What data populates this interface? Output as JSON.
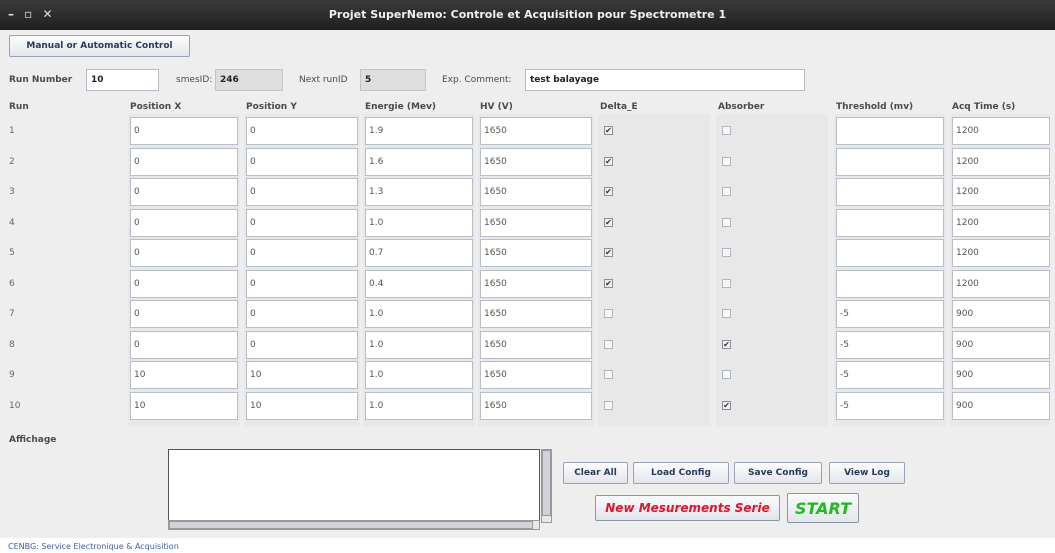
{
  "window": {
    "controls": "– ▫ ✕",
    "title": "Projet SuperNemo: Controle et Acquisition  pour Spectrometre 1"
  },
  "mode_button": "Manual or Automatic Control",
  "header": {
    "run_number_label": "Run Number",
    "run_number_value": "10",
    "smes_label": "smesID:",
    "smes_value": "246",
    "next_run_label": "Next runID",
    "next_run_value": "5",
    "comment_label": "Exp. Comment:",
    "comment_value": "test balayage"
  },
  "columns": [
    "Run",
    "Position X",
    "Position Y",
    "Energie (Mev)",
    "HV (V)",
    "Delta_E",
    "Absorber",
    "Threshold (mv)",
    "Acq Time (s)"
  ],
  "rows": [
    {
      "run": "1",
      "x": "0",
      "y": "0",
      "energie": "1.9",
      "hv": "1650",
      "delta": true,
      "absorber": false,
      "threshold": "",
      "acq": "1200"
    },
    {
      "run": "2",
      "x": "0",
      "y": "0",
      "energie": "1.6",
      "hv": "1650",
      "delta": true,
      "absorber": false,
      "threshold": "",
      "acq": "1200"
    },
    {
      "run": "3",
      "x": "0",
      "y": "0",
      "energie": "1.3",
      "hv": "1650",
      "delta": true,
      "absorber": false,
      "threshold": "",
      "acq": "1200"
    },
    {
      "run": "4",
      "x": "0",
      "y": "0",
      "energie": "1.0",
      "hv": "1650",
      "delta": true,
      "absorber": false,
      "threshold": "",
      "acq": "1200"
    },
    {
      "run": "5",
      "x": "0",
      "y": "0",
      "energie": "0.7",
      "hv": "1650",
      "delta": true,
      "absorber": false,
      "threshold": "",
      "acq": "1200"
    },
    {
      "run": "6",
      "x": "0",
      "y": "0",
      "energie": "0.4",
      "hv": "1650",
      "delta": true,
      "absorber": false,
      "threshold": "",
      "acq": "1200"
    },
    {
      "run": "7",
      "x": "0",
      "y": "0",
      "energie": "1.0",
      "hv": "1650",
      "delta": false,
      "absorber": false,
      "threshold": "-5",
      "acq": "900"
    },
    {
      "run": "8",
      "x": "0",
      "y": "0",
      "energie": "1.0",
      "hv": "1650",
      "delta": false,
      "absorber": true,
      "threshold": "-5",
      "acq": "900"
    },
    {
      "run": "9",
      "x": "10",
      "y": "10",
      "energie": "1.0",
      "hv": "1650",
      "delta": false,
      "absorber": false,
      "threshold": "-5",
      "acq": "900"
    },
    {
      "run": "10",
      "x": "10",
      "y": "10",
      "energie": "1.0",
      "hv": "1650",
      "delta": false,
      "absorber": true,
      "threshold": "-5",
      "acq": "900"
    }
  ],
  "affichage_label": "Affichage",
  "buttons": {
    "clear_all": "Clear All",
    "load_config": "Load Config",
    "save_config": "Save Config",
    "view_log": "View Log",
    "new_series": "New Mesurements Serie",
    "start": "START"
  },
  "footer": "CENBG: Service Electronique & Acquisition",
  "colors": {
    "new_series_text": "#e0142a",
    "start_text": "#22b822",
    "button_text": "#2a3a5a"
  },
  "icons": {
    "checked": "✔"
  }
}
